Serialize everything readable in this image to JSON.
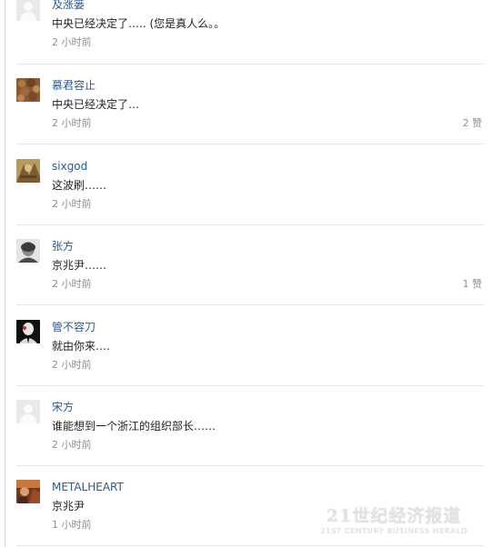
{
  "comments": [
    {
      "name": "及涨篓",
      "text": "中央已经决定了….. (您是真人么。。",
      "time": "2 小时前",
      "likes": ""
    },
    {
      "name": "慕君容止",
      "text": "中央已经决定了…",
      "time": "2 小时前",
      "likes": "2 赞"
    },
    {
      "name": "sixgod",
      "text": "这波刷……",
      "time": "2 小时前",
      "likes": ""
    },
    {
      "name": "张方",
      "text": "京兆尹……",
      "time": "2 小时前",
      "likes": "1 赞"
    },
    {
      "name": "管不容刀",
      "text": "就由你来….",
      "time": "2 小时前",
      "likes": ""
    },
    {
      "name": "宋方",
      "text": "谁能想到一个浙江的组织部长……",
      "time": "2 小时前",
      "likes": ""
    },
    {
      "name": "METALHEART",
      "text": "京兆尹",
      "time": "1 小时前",
      "likes": ""
    }
  ],
  "watermark": {
    "main": "21世纪经济报道",
    "sub": "21ST CENTURY BUSINESS HERALD"
  },
  "colors": {
    "name_link": "#2a5a8c",
    "meta_gray": "#8f8f8f",
    "divider": "#e6e6e6"
  }
}
